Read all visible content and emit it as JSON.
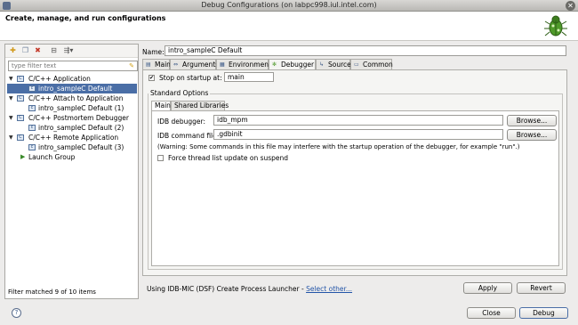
{
  "window": {
    "title": "Debug Configurations  (on labpc998.iul.intel.com)"
  },
  "banner": {
    "heading": "Create, manage, and run configurations"
  },
  "left": {
    "filter_placeholder": "type filter text",
    "tree": [
      {
        "label": "C/C++ Application",
        "level": 0,
        "expanded": true
      },
      {
        "label": "intro_sampleC Default",
        "level": 1,
        "selected": true
      },
      {
        "label": "C/C++ Attach to Application",
        "level": 0,
        "expanded": true
      },
      {
        "label": "intro_sampleC Default (1)",
        "level": 1
      },
      {
        "label": "C/C++ Postmortem Debugger",
        "level": 0,
        "expanded": true
      },
      {
        "label": "intro_sampleC Default (2)",
        "level": 1
      },
      {
        "label": "C/C++ Remote Application",
        "level": 0,
        "expanded": true
      },
      {
        "label": "intro_sampleC Default (3)",
        "level": 1
      },
      {
        "label": "Launch Group",
        "level": 0
      }
    ],
    "status": "Filter matched 9 of 10 items"
  },
  "config": {
    "name_label": "Name:",
    "name_value": "intro_sampleC Default",
    "tabs": [
      "Main",
      "Arguments",
      "Environment",
      "Debugger",
      "Source",
      "Common"
    ],
    "active_tab": "Debugger",
    "stop_on_startup_label": "Stop on startup at:",
    "stop_on_startup_checked": true,
    "stop_on_startup_value": "main",
    "standard_options_title": "Standard Options",
    "inner_tabs": [
      "Main",
      "Shared Libraries"
    ],
    "idb_debugger_label": "IDB debugger:",
    "idb_debugger_value": "idb_mpm",
    "idb_command_label": "IDB command file:",
    "idb_command_value": ".gdbinit",
    "browse_label": "Browse...",
    "warning": "(Warning: Some commands in this file may interfere with the startup operation of the debugger, for example \"run\".)",
    "force_thread_label": "Force thread list update on suspend",
    "force_thread_checked": false
  },
  "footer": {
    "launcher_text": "Using IDB-MIC (DSF) Create Process Launcher - ",
    "launcher_link": "Select other...",
    "apply": "Apply",
    "revert": "Revert",
    "close": "Close",
    "debug": "Debug"
  }
}
